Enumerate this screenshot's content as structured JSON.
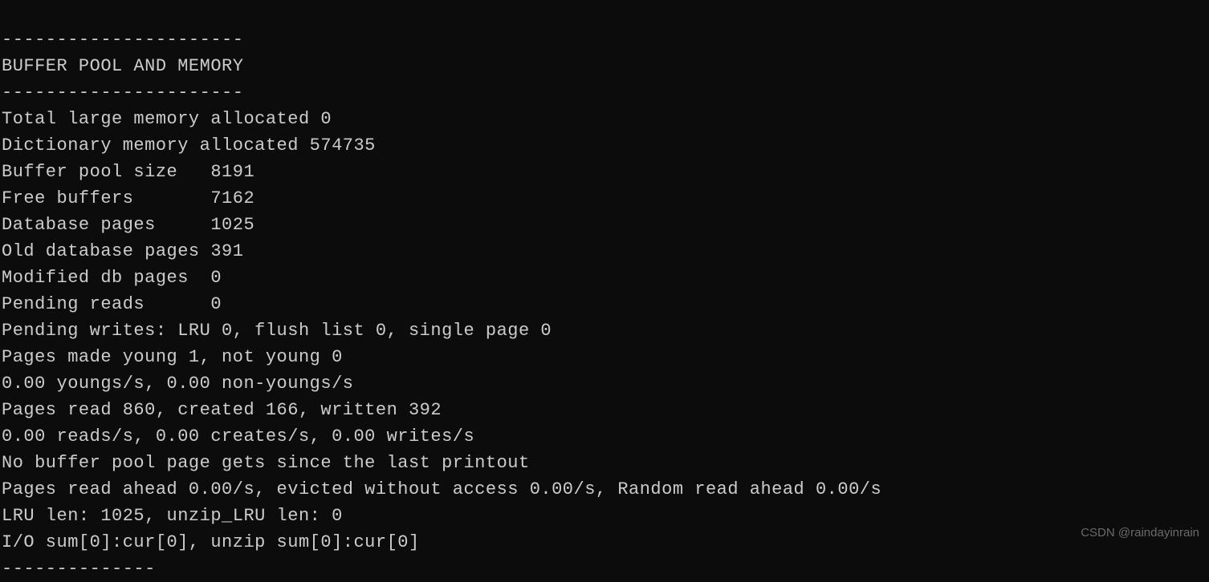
{
  "terminal": {
    "lines": [
      "----------------------",
      "BUFFER POOL AND MEMORY",
      "----------------------",
      "Total large memory allocated 0",
      "Dictionary memory allocated 574735",
      "Buffer pool size   8191",
      "Free buffers       7162",
      "Database pages     1025",
      "Old database pages 391",
      "Modified db pages  0",
      "Pending reads      0",
      "Pending writes: LRU 0, flush list 0, single page 0",
      "Pages made young 1, not young 0",
      "0.00 youngs/s, 0.00 non-youngs/s",
      "Pages read 860, created 166, written 392",
      "0.00 reads/s, 0.00 creates/s, 0.00 writes/s",
      "No buffer pool page gets since the last printout",
      "Pages read ahead 0.00/s, evicted without access 0.00/s, Random read ahead 0.00/s",
      "LRU len: 1025, unzip_LRU len: 0",
      "I/O sum[0]:cur[0], unzip sum[0]:cur[0]",
      "--------------"
    ]
  },
  "watermark": {
    "text": "CSDN @raindayinrain"
  }
}
